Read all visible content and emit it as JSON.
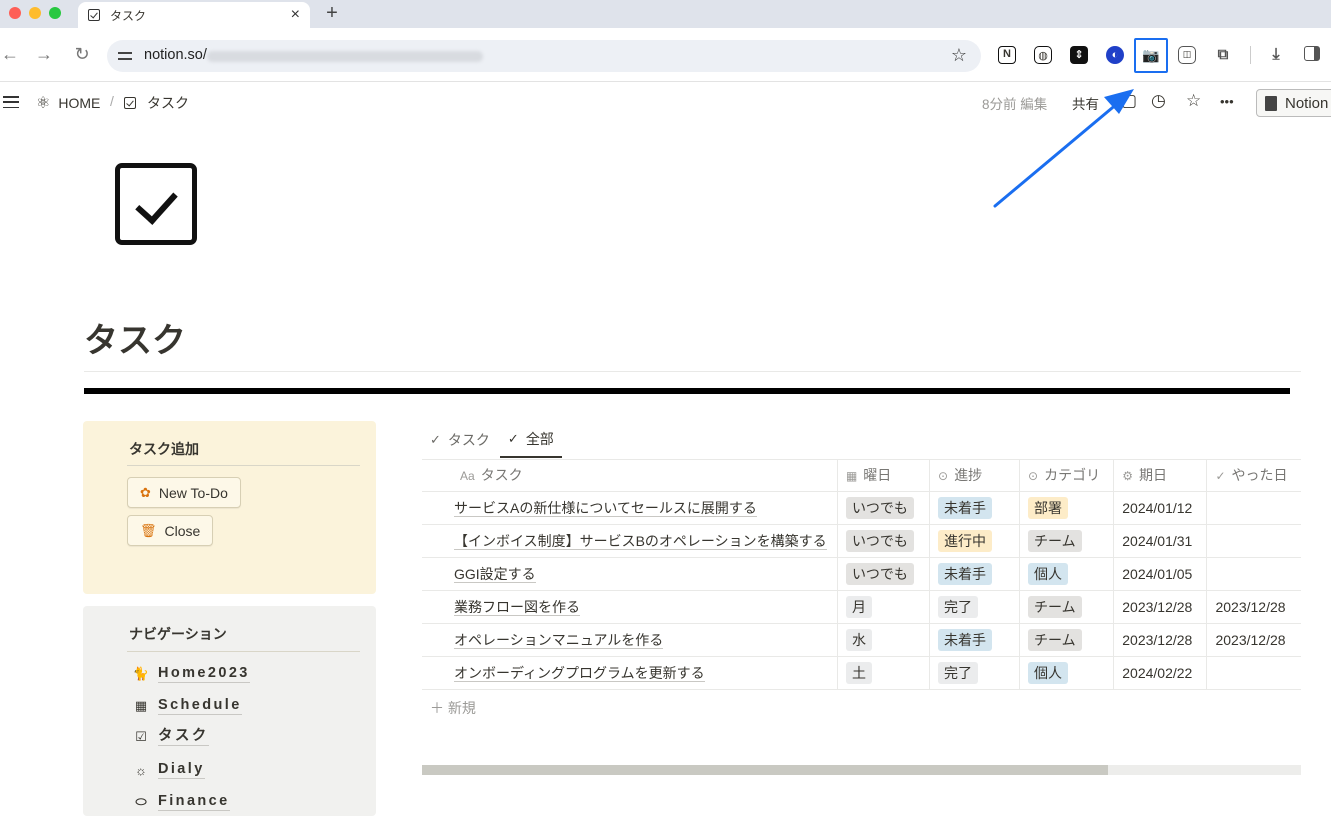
{
  "browser": {
    "tab_title": "タスク",
    "tab_close": "×",
    "new_tab": "+",
    "url": "notion.so/",
    "back": "←",
    "forward": "→",
    "reload": "↻",
    "bookmark_star": "☆"
  },
  "extensions": {
    "notion": "N",
    "ext2": "◍",
    "ext3": "⇕",
    "ext4": "◐",
    "camera": "📷",
    "ext6": "◫",
    "puzzle": "⧉",
    "download": "⤓"
  },
  "topbar": {
    "breadcrumb": [
      {
        "label": "HOME",
        "icon": "atom-icon"
      },
      {
        "label": "タスク",
        "icon": "checkbox-icon"
      }
    ],
    "separator": "/",
    "edited": "8分前 編集",
    "share": "共有",
    "history_icon": "◷",
    "favorite_icon": "☆",
    "more_icon": "•••",
    "notion_button": "Notion"
  },
  "page": {
    "title": "タスク"
  },
  "task_panel": {
    "heading": "タスク追加",
    "buttons": [
      {
        "label": "New To-Do",
        "icon": "flower-icon"
      },
      {
        "label": "Close",
        "icon": "trash-icon"
      }
    ]
  },
  "nav_panel": {
    "heading": "ナビゲーション",
    "items": [
      {
        "label": "Home2023",
        "icon": "cat-icon"
      },
      {
        "label": "Schedule",
        "icon": "calendar-icon"
      },
      {
        "label": "タスク",
        "icon": "checkbox-icon"
      },
      {
        "label": "Dialy",
        "icon": "sunrise-icon"
      },
      {
        "label": "Finance",
        "icon": "piggy-bank-icon"
      }
    ]
  },
  "database": {
    "views": [
      {
        "label": "タスク",
        "active": false
      },
      {
        "label": "全部",
        "active": true
      }
    ],
    "columns": [
      "タスク",
      "曜日",
      "進捗",
      "カテゴリ",
      "期日",
      "やった日"
    ],
    "column_icons": [
      "Aa",
      "▦",
      "⊙",
      "⊙",
      "⚙",
      "✓"
    ],
    "rows": [
      {
        "task": "サービスAの新仕様についてセールスに展開する",
        "day": "いつでも",
        "status": "未着手",
        "category": "部署",
        "due": "2024/01/12",
        "done": ""
      },
      {
        "task": "【インボイス制度】サービスBのオペレーションを構築する",
        "day": "いつでも",
        "status": "進行中",
        "category": "チーム",
        "due": "2024/01/31",
        "done": ""
      },
      {
        "task": "GGI設定する",
        "day": "いつでも",
        "status": "未着手",
        "category": "個人",
        "due": "2024/01/05",
        "done": ""
      },
      {
        "task": "業務フロー図を作る",
        "day": "月",
        "status": "完了",
        "category": "チーム",
        "due": "2023/12/28",
        "done": "2023/12/28"
      },
      {
        "task": "オペレーションマニュアルを作る",
        "day": "水",
        "status": "未着手",
        "category": "チーム",
        "due": "2023/12/28",
        "done": "2023/12/28"
      },
      {
        "task": "オンボーディングプログラムを更新する",
        "day": "土",
        "status": "完了",
        "category": "個人",
        "due": "2024/02/22",
        "done": ""
      }
    ],
    "new_row": "新規",
    "horizontal_scroll_fraction": 0.78
  },
  "colors": {
    "highlight": "#1a6ef0",
    "panel_yellow": "#fbf3db",
    "panel_gray": "#f1f1ef"
  }
}
